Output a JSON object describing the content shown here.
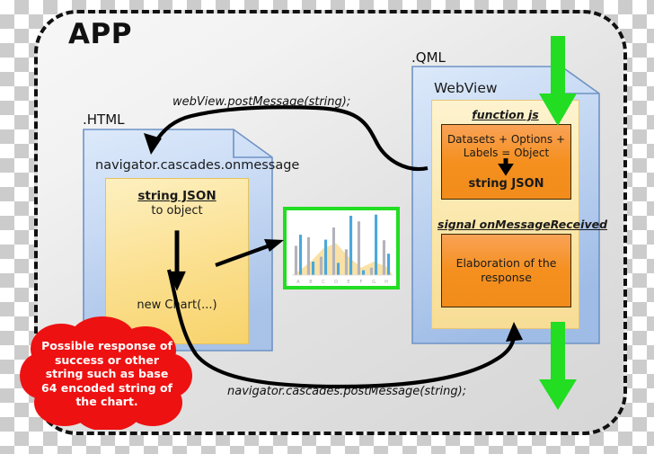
{
  "app": {
    "title": "APP",
    "border_color": "#111111",
    "background": "#e8e8e8"
  },
  "html_document": {
    "caption": ".HTML",
    "title": "navigator.cascades.onmessage",
    "panel": {
      "heading": "string JSON",
      "subheading": "to object",
      "result": "new Chart(...)"
    },
    "fill_color": "#c3d6f0",
    "panel_color": "#fbdf8e"
  },
  "qml_document": {
    "caption": ".QML",
    "title": "WebView",
    "function_section": {
      "label": "function js",
      "line1": "Datasets + Options + Labels = Object",
      "line2": "string JSON"
    },
    "signal_section": {
      "label": "signal onMessageReceived",
      "text": "Elaboration of the response"
    },
    "fill_color": "#c3d6f0",
    "panel_color": "#fae6a8",
    "box_color": "#f5901f"
  },
  "arrows": {
    "top_label": "webView.postMessage(string);",
    "bottom_label": "navigator.cascades.postMessage(string);",
    "green_color": "#22dd22",
    "black_color": "#000000"
  },
  "cloud": {
    "text": "Possible response of success or other string such as base 64 encoded string of the chart.",
    "color": "#ee1111",
    "text_color": "#ffffff"
  },
  "chart_data": {
    "type": "bar",
    "title": "",
    "xlabel": "",
    "ylabel": "",
    "categories": [
      "A",
      "B",
      "C",
      "D",
      "E",
      "F",
      "G",
      "H"
    ],
    "series": [
      {
        "name": "gray",
        "color": "#b3b3bd",
        "values": [
          48,
          62,
          30,
          78,
          42,
          88,
          12,
          57
        ]
      },
      {
        "name": "blue",
        "color": "#4aa8dd",
        "values": [
          66,
          22,
          58,
          20,
          97,
          8,
          99,
          35
        ]
      },
      {
        "name": "area",
        "color": "#fadfa0",
        "values": [
          6,
          22,
          44,
          52,
          30,
          12,
          22,
          14
        ]
      }
    ],
    "ylim": [
      0,
      100
    ],
    "grid": false,
    "legend": "none",
    "border_color": "#22dd22",
    "background": "#ffffff"
  }
}
